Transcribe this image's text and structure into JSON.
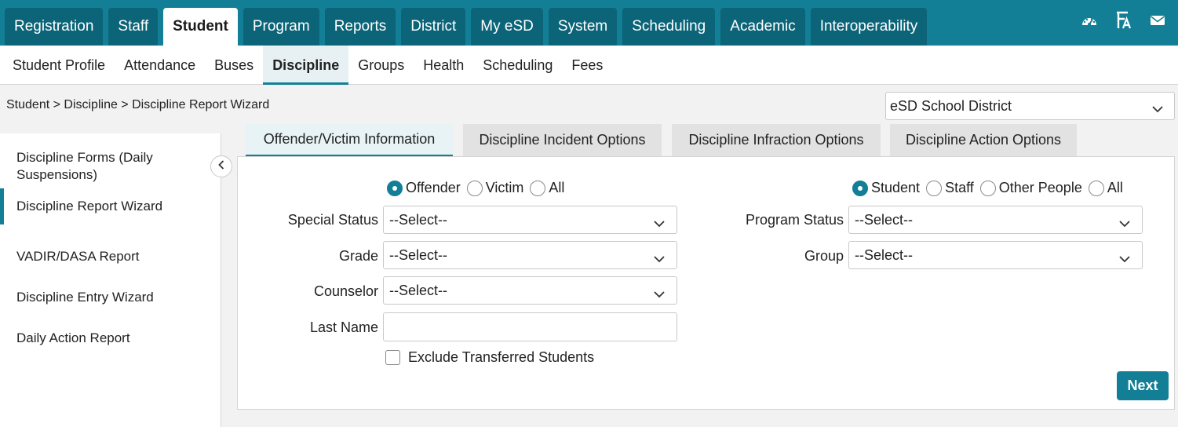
{
  "top_nav": {
    "tabs": [
      {
        "label": "Registration"
      },
      {
        "label": "Staff"
      },
      {
        "label": "Student"
      },
      {
        "label": "Program"
      },
      {
        "label": "Reports"
      },
      {
        "label": "District"
      },
      {
        "label": "My eSD"
      },
      {
        "label": "System"
      },
      {
        "label": "Scheduling"
      },
      {
        "label": "Academic"
      },
      {
        "label": "Interoperability"
      }
    ],
    "active_tab": "Student",
    "icons": [
      "dashboard-icon",
      "font-language-icon",
      "mail-icon"
    ]
  },
  "sub_nav": {
    "items": [
      {
        "label": "Student Profile"
      },
      {
        "label": "Attendance"
      },
      {
        "label": "Buses"
      },
      {
        "label": "Discipline"
      },
      {
        "label": "Groups"
      },
      {
        "label": "Health"
      },
      {
        "label": "Scheduling"
      },
      {
        "label": "Fees"
      }
    ],
    "active_item": "Discipline"
  },
  "breadcrumb": "Student > Discipline > Discipline Report Wizard",
  "district_select": {
    "value": "eSD School District"
  },
  "sidebar": {
    "items": [
      {
        "label": "Discipline Forms (Daily Suspensions)"
      },
      {
        "label": "Discipline Report Wizard"
      },
      {
        "label": "VADIR/DASA Report"
      },
      {
        "label": "Discipline Entry Wizard"
      },
      {
        "label": "Daily Action Report"
      }
    ],
    "active_item": "Discipline Report Wizard"
  },
  "wizard_tabs": [
    {
      "label": "Offender/Victim Information"
    },
    {
      "label": "Discipline Incident Options"
    },
    {
      "label": "Discipline Infraction Options"
    },
    {
      "label": "Discipline Action Options"
    }
  ],
  "form": {
    "role_radio": {
      "options": [
        "Offender",
        "Victim",
        "All"
      ],
      "selected": "Offender"
    },
    "person_radio": {
      "options": [
        "Student",
        "Staff",
        "Other People",
        "All"
      ],
      "selected": "Student"
    },
    "special_status": {
      "label": "Special Status",
      "value": "--Select--"
    },
    "grade": {
      "label": "Grade",
      "value": "--Select--"
    },
    "counselor": {
      "label": "Counselor",
      "value": "--Select--"
    },
    "last_name": {
      "label": "Last Name",
      "value": ""
    },
    "program_status": {
      "label": "Program Status",
      "value": "--Select--"
    },
    "group": {
      "label": "Group",
      "value": "--Select--"
    },
    "exclude_transferred": {
      "label": "Exclude Transferred Students",
      "checked": false
    },
    "next_label": "Next"
  },
  "colors": {
    "brand": "#137f96",
    "tab_dark": "#0c6478"
  }
}
